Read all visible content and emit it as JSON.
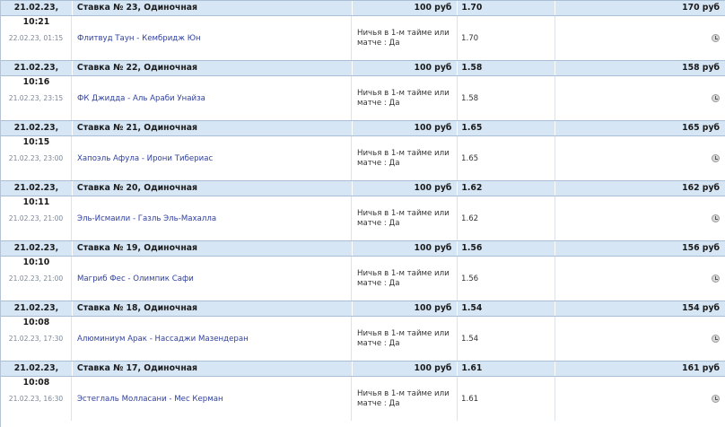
{
  "bets": [
    {
      "placed": "21.02.23, 10:21",
      "title": "Ставка № 23, Одиночная",
      "amount": "100 руб",
      "coef": "1.70",
      "payout": "170 руб",
      "event_date": "22.02.23, 01:15",
      "match": "Флитвуд Таун - Кембридж Юн",
      "outcome": "Ничья в 1-м тайме или матче : Да",
      "event_coef": "1.70",
      "status_icon": "clock-icon"
    },
    {
      "placed": "21.02.23, 10:16",
      "title": "Ставка № 22, Одиночная",
      "amount": "100 руб",
      "coef": "1.58",
      "payout": "158 руб",
      "event_date": "21.02.23, 23:15",
      "match": "ФК Джидда - Аль Араби Унайза",
      "outcome": "Ничья в 1-м тайме или матче : Да",
      "event_coef": "1.58",
      "status_icon": "clock-icon"
    },
    {
      "placed": "21.02.23, 10:15",
      "title": "Ставка № 21, Одиночная",
      "amount": "100 руб",
      "coef": "1.65",
      "payout": "165 руб",
      "event_date": "21.02.23, 23:00",
      "match": "Хапоэль Афула - Ирони Тибериас",
      "outcome": "Ничья в 1-м тайме или матче : Да",
      "event_coef": "1.65",
      "status_icon": "clock-icon"
    },
    {
      "placed": "21.02.23, 10:11",
      "title": "Ставка № 20, Одиночная",
      "amount": "100 руб",
      "coef": "1.62",
      "payout": "162 руб",
      "event_date": "21.02.23, 21:00",
      "match": "Эль-Исмаили - Газль Эль-Махалла",
      "outcome": "Ничья в 1-м тайме или матче : Да",
      "event_coef": "1.62",
      "status_icon": "clock-icon"
    },
    {
      "placed": "21.02.23, 10:10",
      "title": "Ставка № 19, Одиночная",
      "amount": "100 руб",
      "coef": "1.56",
      "payout": "156 руб",
      "event_date": "21.02.23, 21:00",
      "match": "Магриб Фес - Олимпик Сафи",
      "outcome": "Ничья в 1-м тайме или матче : Да",
      "event_coef": "1.56",
      "status_icon": "clock-icon"
    },
    {
      "placed": "21.02.23, 10:08",
      "title": "Ставка № 18, Одиночная",
      "amount": "100 руб",
      "coef": "1.54",
      "payout": "154 руб",
      "event_date": "21.02.23, 17:30",
      "match": "Алюминиум Арак - Нассаджи Мазендеран",
      "outcome": "Ничья в 1-м тайме или матче : Да",
      "event_coef": "1.54",
      "status_icon": "clock-icon"
    },
    {
      "placed": "21.02.23, 10:08",
      "title": "Ставка № 17, Одиночная",
      "amount": "100 руб",
      "coef": "1.61",
      "payout": "161 руб",
      "event_date": "21.02.23, 16:30",
      "match": "Эстеглаль Молласани - Мес Керман",
      "outcome": "Ничья в 1-м тайме или матче : Да",
      "event_coef": "1.61",
      "status_icon": "clock-icon"
    }
  ]
}
